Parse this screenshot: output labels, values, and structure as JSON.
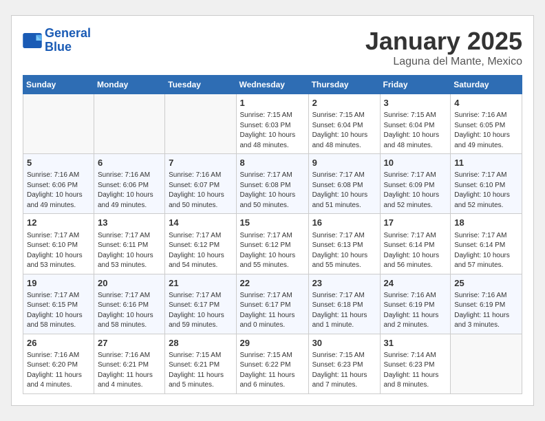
{
  "header": {
    "logo_line1": "General",
    "logo_line2": "Blue",
    "month": "January 2025",
    "location": "Laguna del Mante, Mexico"
  },
  "weekdays": [
    "Sunday",
    "Monday",
    "Tuesday",
    "Wednesday",
    "Thursday",
    "Friday",
    "Saturday"
  ],
  "weeks": [
    [
      {
        "day": "",
        "info": ""
      },
      {
        "day": "",
        "info": ""
      },
      {
        "day": "",
        "info": ""
      },
      {
        "day": "1",
        "info": "Sunrise: 7:15 AM\nSunset: 6:03 PM\nDaylight: 10 hours\nand 48 minutes."
      },
      {
        "day": "2",
        "info": "Sunrise: 7:15 AM\nSunset: 6:04 PM\nDaylight: 10 hours\nand 48 minutes."
      },
      {
        "day": "3",
        "info": "Sunrise: 7:15 AM\nSunset: 6:04 PM\nDaylight: 10 hours\nand 48 minutes."
      },
      {
        "day": "4",
        "info": "Sunrise: 7:16 AM\nSunset: 6:05 PM\nDaylight: 10 hours\nand 49 minutes."
      }
    ],
    [
      {
        "day": "5",
        "info": "Sunrise: 7:16 AM\nSunset: 6:06 PM\nDaylight: 10 hours\nand 49 minutes."
      },
      {
        "day": "6",
        "info": "Sunrise: 7:16 AM\nSunset: 6:06 PM\nDaylight: 10 hours\nand 49 minutes."
      },
      {
        "day": "7",
        "info": "Sunrise: 7:16 AM\nSunset: 6:07 PM\nDaylight: 10 hours\nand 50 minutes."
      },
      {
        "day": "8",
        "info": "Sunrise: 7:17 AM\nSunset: 6:08 PM\nDaylight: 10 hours\nand 50 minutes."
      },
      {
        "day": "9",
        "info": "Sunrise: 7:17 AM\nSunset: 6:08 PM\nDaylight: 10 hours\nand 51 minutes."
      },
      {
        "day": "10",
        "info": "Sunrise: 7:17 AM\nSunset: 6:09 PM\nDaylight: 10 hours\nand 52 minutes."
      },
      {
        "day": "11",
        "info": "Sunrise: 7:17 AM\nSunset: 6:10 PM\nDaylight: 10 hours\nand 52 minutes."
      }
    ],
    [
      {
        "day": "12",
        "info": "Sunrise: 7:17 AM\nSunset: 6:10 PM\nDaylight: 10 hours\nand 53 minutes."
      },
      {
        "day": "13",
        "info": "Sunrise: 7:17 AM\nSunset: 6:11 PM\nDaylight: 10 hours\nand 53 minutes."
      },
      {
        "day": "14",
        "info": "Sunrise: 7:17 AM\nSunset: 6:12 PM\nDaylight: 10 hours\nand 54 minutes."
      },
      {
        "day": "15",
        "info": "Sunrise: 7:17 AM\nSunset: 6:12 PM\nDaylight: 10 hours\nand 55 minutes."
      },
      {
        "day": "16",
        "info": "Sunrise: 7:17 AM\nSunset: 6:13 PM\nDaylight: 10 hours\nand 55 minutes."
      },
      {
        "day": "17",
        "info": "Sunrise: 7:17 AM\nSunset: 6:14 PM\nDaylight: 10 hours\nand 56 minutes."
      },
      {
        "day": "18",
        "info": "Sunrise: 7:17 AM\nSunset: 6:14 PM\nDaylight: 10 hours\nand 57 minutes."
      }
    ],
    [
      {
        "day": "19",
        "info": "Sunrise: 7:17 AM\nSunset: 6:15 PM\nDaylight: 10 hours\nand 58 minutes."
      },
      {
        "day": "20",
        "info": "Sunrise: 7:17 AM\nSunset: 6:16 PM\nDaylight: 10 hours\nand 58 minutes."
      },
      {
        "day": "21",
        "info": "Sunrise: 7:17 AM\nSunset: 6:17 PM\nDaylight: 10 hours\nand 59 minutes."
      },
      {
        "day": "22",
        "info": "Sunrise: 7:17 AM\nSunset: 6:17 PM\nDaylight: 11 hours\nand 0 minutes."
      },
      {
        "day": "23",
        "info": "Sunrise: 7:17 AM\nSunset: 6:18 PM\nDaylight: 11 hours\nand 1 minute."
      },
      {
        "day": "24",
        "info": "Sunrise: 7:16 AM\nSunset: 6:19 PM\nDaylight: 11 hours\nand 2 minutes."
      },
      {
        "day": "25",
        "info": "Sunrise: 7:16 AM\nSunset: 6:19 PM\nDaylight: 11 hours\nand 3 minutes."
      }
    ],
    [
      {
        "day": "26",
        "info": "Sunrise: 7:16 AM\nSunset: 6:20 PM\nDaylight: 11 hours\nand 4 minutes."
      },
      {
        "day": "27",
        "info": "Sunrise: 7:16 AM\nSunset: 6:21 PM\nDaylight: 11 hours\nand 4 minutes."
      },
      {
        "day": "28",
        "info": "Sunrise: 7:15 AM\nSunset: 6:21 PM\nDaylight: 11 hours\nand 5 minutes."
      },
      {
        "day": "29",
        "info": "Sunrise: 7:15 AM\nSunset: 6:22 PM\nDaylight: 11 hours\nand 6 minutes."
      },
      {
        "day": "30",
        "info": "Sunrise: 7:15 AM\nSunset: 6:23 PM\nDaylight: 11 hours\nand 7 minutes."
      },
      {
        "day": "31",
        "info": "Sunrise: 7:14 AM\nSunset: 6:23 PM\nDaylight: 11 hours\nand 8 minutes."
      },
      {
        "day": "",
        "info": ""
      }
    ]
  ]
}
